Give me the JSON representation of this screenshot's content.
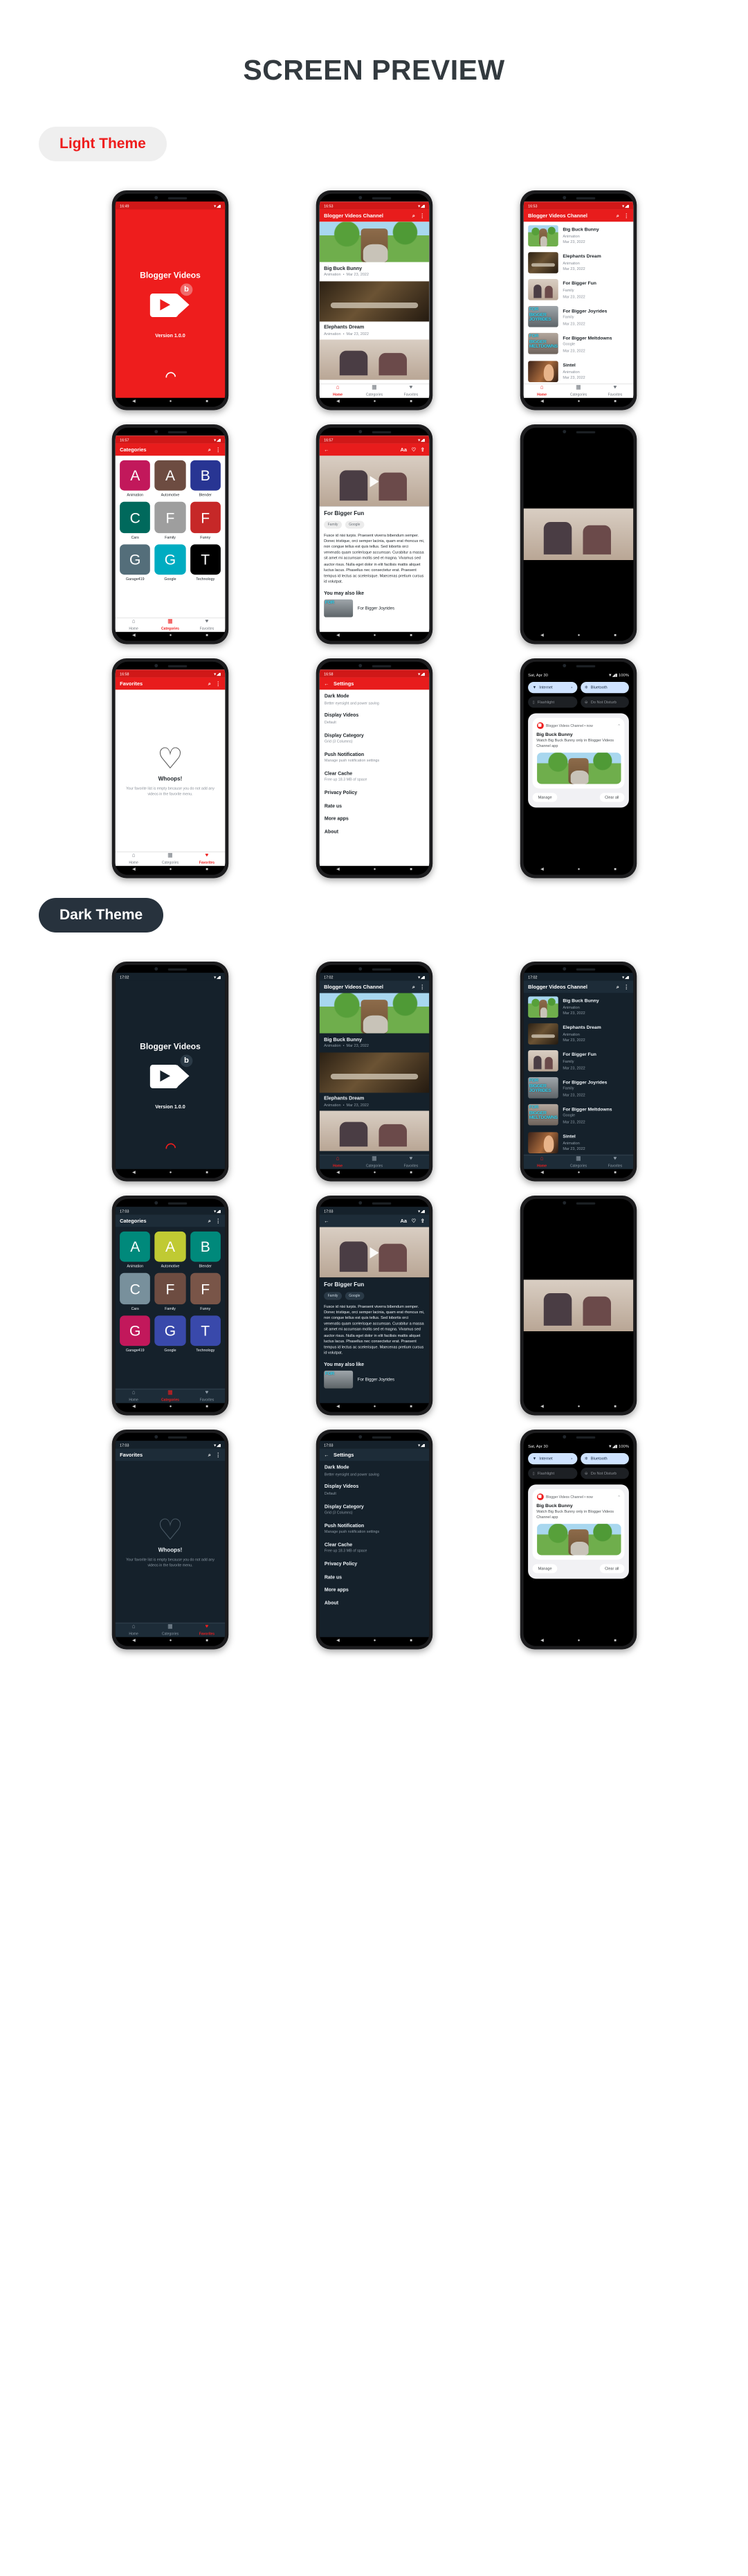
{
  "header": {
    "title": "SCREEN PREVIEW"
  },
  "themes": {
    "light_label": "Light Theme",
    "dark_label": "Dark Theme"
  },
  "colors": {
    "brand_red": "#ee1d1d",
    "appbar_red": "#e81c1c",
    "dark_bg": "#15212b",
    "dark_appbar": "#1d2c38",
    "pill_light_bg": "#efefef",
    "pill_dark_bg": "#27323d",
    "title_gray": "#333a3f"
  },
  "app": {
    "name": "Blogger Videos",
    "channel_title": "Blogger Videos Channel",
    "version": "Version 1.0.0"
  },
  "status": {
    "time_splash_light": "16:49",
    "time_home_light": "16:53",
    "time_categories_light": "16:57",
    "time_detail_light": "16:57",
    "time_favorites_light": "16:58",
    "time_settings_light": "16:58",
    "time_splash_dark": "17:02",
    "time_home_dark": "17:02",
    "time_categories_dark": "17:03",
    "time_detail_dark": "17:03",
    "time_favorites_dark": "17:03",
    "time_settings_dark": "17:03",
    "signal_icons": "▼◢▮"
  },
  "bottom_nav": {
    "items": [
      {
        "label": "Home",
        "icon": "home-icon",
        "glyph": "⌂"
      },
      {
        "label": "Categories",
        "icon": "grid-icon",
        "glyph": "▦"
      },
      {
        "label": "Favorites",
        "icon": "heart-icon",
        "glyph": "♥"
      }
    ]
  },
  "appbar_icons": {
    "search": "⌕",
    "overflow": "⋮",
    "back": "←",
    "font_size": "Aa",
    "favorite": "♡",
    "share": "⇪"
  },
  "videos": [
    {
      "title": "Big Buck Bunny",
      "category": "Animation",
      "date": "Mar 23, 2022",
      "art": "art-bunny"
    },
    {
      "title": "Elephants Dream",
      "category": "Animation",
      "date": "Mar 23, 2022",
      "art": "art-eleph"
    },
    {
      "title": "For Bigger Fun",
      "category": "Family",
      "date": "Mar 23, 2022",
      "art": "art-fun"
    },
    {
      "title": "For Bigger Joyrides",
      "category": "Family",
      "date": "Mar 23, 2022",
      "art": "art-joy",
      "overlay": "FOR BIGGER JOYRIDES"
    },
    {
      "title": "For Bigger Meltdowns",
      "category": "Google",
      "date": "Mar 23, 2022",
      "art": "art-melt",
      "overlay": "FOR BIGGER MELTDOWNS"
    },
    {
      "title": "Sintel",
      "category": "Animation",
      "date": "Mar 23, 2022",
      "art": "art-sintel"
    }
  ],
  "categories_screen": {
    "title": "Categories",
    "items": [
      {
        "letter": "A",
        "label": "Animation",
        "color_light": "#c2185b",
        "color_dark": "#00897b"
      },
      {
        "letter": "A",
        "label": "Automotive",
        "color_light": "#6d4c41",
        "color_dark": "#c0ca33"
      },
      {
        "letter": "B",
        "label": "Blender",
        "color_light": "#283593",
        "color_dark": "#00897b"
      },
      {
        "letter": "C",
        "label": "Cars",
        "color_light": "#00695c",
        "color_dark": "#78909c"
      },
      {
        "letter": "F",
        "label": "Family",
        "color_light": "#9e9e9e",
        "color_dark": "#6d4c41"
      },
      {
        "letter": "F",
        "label": "Funny",
        "color_light": "#c62828",
        "color_dark": "#795548"
      },
      {
        "letter": "G",
        "label": "Garage419",
        "color_light": "#546e7a",
        "color_dark": "#c2185b"
      },
      {
        "letter": "G",
        "label": "Google",
        "color_light": "#00acc1",
        "color_dark": "#3949ab"
      },
      {
        "letter": "T",
        "label": "Technology",
        "color_light": "#000000",
        "color_dark": "#3949ab"
      }
    ]
  },
  "detail_screen": {
    "title": "For Bigger Fun",
    "chips": [
      "Family",
      "Google"
    ],
    "description": "Fusce id nisi turpis. Praesent viverra bibendum semper. Donec tristique, orci semper lacinia, quam erat rhoncus mi, non congue tellus est quis tellus. Sed lobortis orci venenatis quam scelerisque accumsan. Curabitur a massa sit amet mi accumsan mollis sed et magna. Vivamus sed auctor risus. Nulla eget dolor in elit facilisis mattis aliquet luctus lacus. Phasellus nec consectetur erat. Praesent tempus id lectus ac scelerisque. Maecenas pretium cursus id volutpat.",
    "related_heading": "You may also like",
    "related": [
      {
        "title": "For Bigger Joyrides",
        "art": "art-joy",
        "overlay": "FOR"
      }
    ]
  },
  "favorites_screen": {
    "title": "Favorites",
    "empty_heading": "Whoops!",
    "empty_text": "Your favorite list is empty because you do not add any videos in the favorite menu."
  },
  "settings_screen": {
    "title": "Settings",
    "items": [
      {
        "title": "Dark Mode",
        "subtitle": "Better eyesight and power saving"
      },
      {
        "title": "Display Videos",
        "subtitle": "Default"
      },
      {
        "title": "Display Category",
        "subtitle": "Grid (3 Columns)"
      },
      {
        "title": "Push Notification",
        "subtitle": "Manage push notification settings"
      },
      {
        "title": "Clear Cache",
        "subtitle": "Free up 18.3 MB of space"
      },
      {
        "title": "Privacy Policy",
        "subtitle": ""
      },
      {
        "title": "Rate us",
        "subtitle": ""
      },
      {
        "title": "More apps",
        "subtitle": ""
      },
      {
        "title": "About",
        "subtitle": ""
      }
    ]
  },
  "notification_screen": {
    "date": "Sat, Apr 30",
    "battery": "100%",
    "quick_settings": [
      {
        "label": "Internet",
        "icon": "wifi-icon",
        "glyph": "▼",
        "state": "on",
        "chevron": "›"
      },
      {
        "label": "Bluetooth",
        "icon": "bluetooth-icon",
        "glyph": "✲",
        "state": "on",
        "chevron": ""
      },
      {
        "label": "Flashlight",
        "icon": "flashlight-icon",
        "glyph": "▯",
        "state": "off",
        "chevron": ""
      },
      {
        "label": "Do Not Disturb",
        "icon": "dnd-icon",
        "glyph": "⊖",
        "state": "off",
        "chevron": ""
      }
    ],
    "notification": {
      "app": "Blogger Videos Channel",
      "time": "now",
      "title": "Big Buck Bunny",
      "text": "Watch Big Buck Bunny only in Blogger Videos Channel app",
      "collapse_icon": "⌃"
    },
    "actions": {
      "manage": "Manage",
      "clear_all": "Clear all"
    }
  },
  "navbar": {
    "back": "◀",
    "home": "●",
    "recents": "■"
  }
}
